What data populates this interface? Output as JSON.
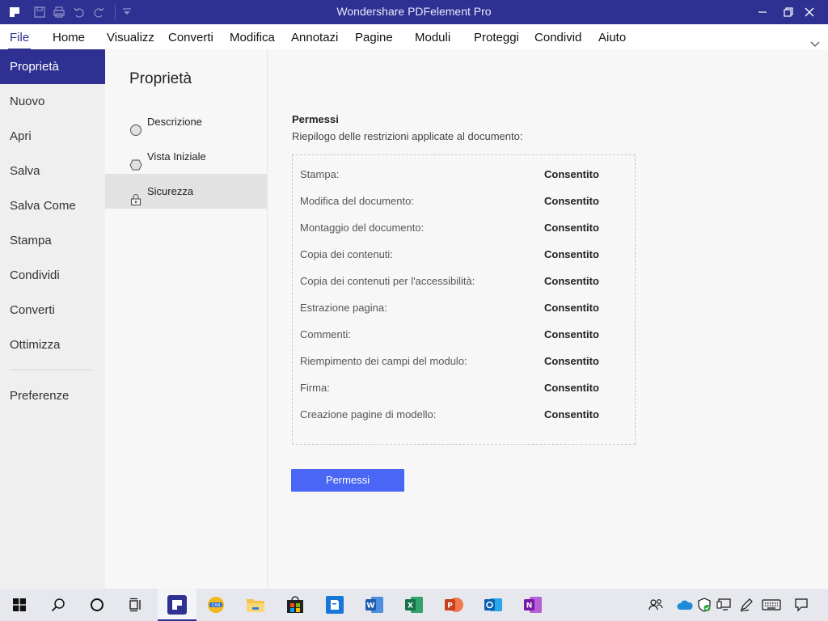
{
  "window": {
    "title": "Wondershare PDFelement Pro"
  },
  "menubar": {
    "items": [
      "File",
      "Home",
      "Visualizz",
      "Converti",
      "Modifica",
      "Annotazi",
      "Pagine",
      "Moduli",
      "Proteggi",
      "Condivid",
      "Aiuto"
    ],
    "active": "File"
  },
  "sidebar": {
    "items": [
      "Proprietà",
      "Nuovo",
      "Apri",
      "Salva",
      "Salva Come",
      "Stampa",
      "Condividi",
      "Converti",
      "Ottimizza"
    ],
    "bottom_item": "Preferenze",
    "active": "Proprietà"
  },
  "properties": {
    "title": "Proprietà",
    "items": [
      {
        "label": "Descrizione",
        "icon": "circle-icon"
      },
      {
        "label": "Vista Iniziale",
        "icon": "hexagon-icon"
      },
      {
        "label": "Sicurezza",
        "icon": "lock-icon"
      }
    ],
    "active": "Sicurezza"
  },
  "permissions": {
    "title": "Permessi",
    "subtitle": "Riepilogo delle restrizioni applicate al documento:",
    "rows": [
      {
        "label": "Stampa:",
        "value": "Consentito"
      },
      {
        "label": "Modifica del documento:",
        "value": "Consentito"
      },
      {
        "label": "Montaggio del documento:",
        "value": "Consentito"
      },
      {
        "label": "Copia dei contenuti:",
        "value": "Consentito"
      },
      {
        "label": "Copia dei contenuti per l'accessibilità:",
        "value": "Consentito"
      },
      {
        "label": "Estrazione pagina:",
        "value": "Consentito"
      },
      {
        "label": "Commenti:",
        "value": "Consentito"
      },
      {
        "label": "Riempimento dei campi del modulo:",
        "value": "Consentito"
      },
      {
        "label": "Firma:",
        "value": "Consentito"
      },
      {
        "label": "Creazione pagine di modello:",
        "value": "Consentito"
      }
    ],
    "button_label": "Permessi"
  },
  "colors": {
    "accent": "#2e3191",
    "button": "#4a66f5"
  },
  "taskbar": {
    "apps": [
      "windows-start-icon",
      "search-icon",
      "cortana-icon",
      "task-view-icon",
      "pdfelement-icon",
      "canary-browser-icon",
      "file-explorer-icon",
      "store-icon",
      "pdf-app-icon",
      "word-icon",
      "excel-icon",
      "powerpoint-icon",
      "outlook-icon",
      "onenote-icon"
    ],
    "tray": [
      "people-icon",
      "onedrive-icon",
      "defender-icon",
      "network-icon",
      "pen-icon",
      "keyboard-icon",
      "notifications-icon"
    ]
  }
}
